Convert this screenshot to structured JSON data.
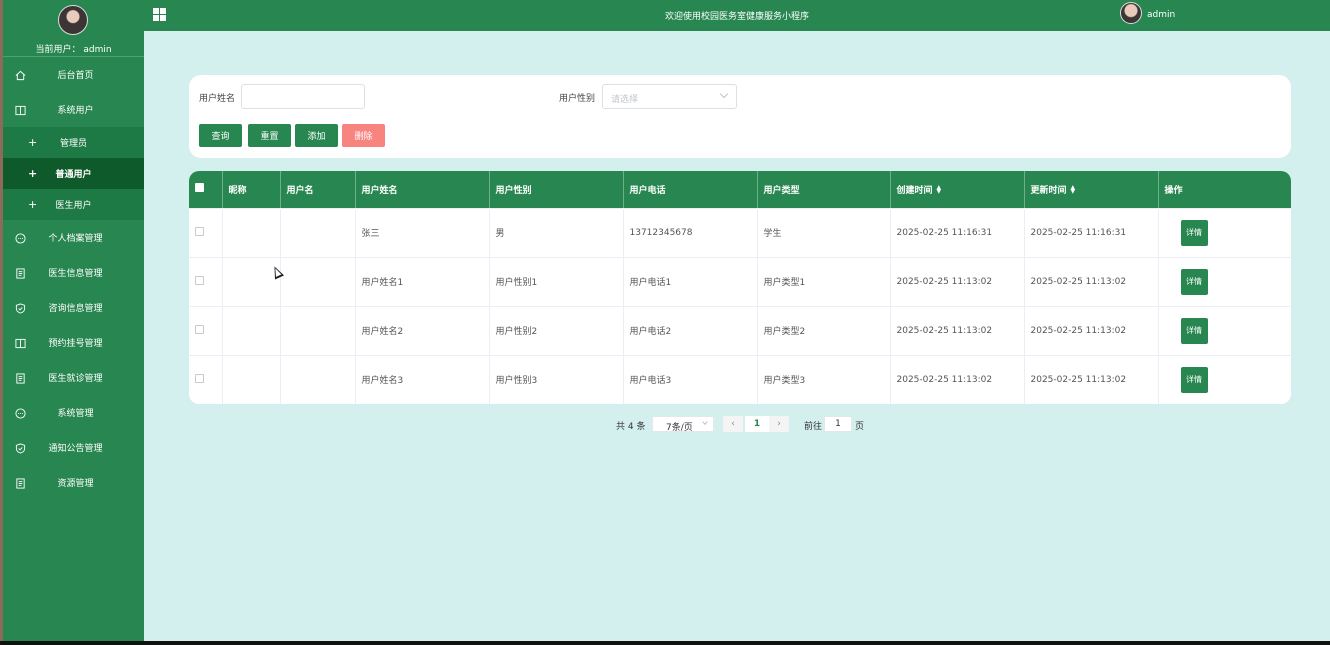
{
  "header": {
    "title": "欢迎使用校园医务室健康服务小程序",
    "username": "admin"
  },
  "sidebar": {
    "current_user_label": "当前用户：",
    "current_user_name": "admin",
    "items": [
      {
        "label": "后台首页",
        "icon": "home-icon"
      },
      {
        "label": "系统用户",
        "icon": "columns-icon"
      },
      {
        "label": "管理员",
        "sub": true
      },
      {
        "label": "普通用户",
        "sub": true,
        "active": true
      },
      {
        "label": "医生用户",
        "sub": true
      },
      {
        "label": "个人档案管理",
        "icon": "chat-icon"
      },
      {
        "label": "医生信息管理",
        "icon": "document-icon"
      },
      {
        "label": "咨询信息管理",
        "icon": "shield-icon"
      },
      {
        "label": "预约挂号管理",
        "icon": "columns-icon"
      },
      {
        "label": "医生就诊管理",
        "icon": "document-icon"
      },
      {
        "label": "系统管理",
        "icon": "chat-icon"
      },
      {
        "label": "通知公告管理",
        "icon": "shield-icon"
      },
      {
        "label": "资源管理",
        "icon": "document-icon"
      }
    ]
  },
  "search": {
    "name_label": "用户姓名",
    "name_value": "",
    "gender_label": "用户性别",
    "gender_placeholder": "请选择",
    "buttons": {
      "query": "查询",
      "reset": "重置",
      "add": "添加",
      "delete": "删除"
    }
  },
  "table": {
    "columns": [
      "昵称",
      "用户名",
      "用户姓名",
      "用户性别",
      "用户电话",
      "用户类型",
      "创建时间",
      "更新时间",
      "操作"
    ],
    "detail_label": "详情",
    "rows": [
      {
        "nickname": "",
        "username": "",
        "name": "张三",
        "gender": "男",
        "phone": "13712345678",
        "type": "学生",
        "created": "2025-02-25 11:16:31",
        "updated": "2025-02-25 11:16:31"
      },
      {
        "nickname": "",
        "username": "",
        "name": "用户姓名1",
        "gender": "用户性别1",
        "phone": "用户电话1",
        "type": "用户类型1",
        "created": "2025-02-25 11:13:02",
        "updated": "2025-02-25 11:13:02"
      },
      {
        "nickname": "",
        "username": "",
        "name": "用户姓名2",
        "gender": "用户性别2",
        "phone": "用户电话2",
        "type": "用户类型2",
        "created": "2025-02-25 11:13:02",
        "updated": "2025-02-25 11:13:02"
      },
      {
        "nickname": "",
        "username": "",
        "name": "用户姓名3",
        "gender": "用户性别3",
        "phone": "用户电话3",
        "type": "用户类型3",
        "created": "2025-02-25 11:13:02",
        "updated": "2025-02-25 11:13:02"
      }
    ]
  },
  "pagination": {
    "total": "共 4 条",
    "page_size": "7条/页",
    "current_page": "1",
    "goto_label": "前往",
    "goto_value": "1",
    "page_suffix": "页"
  },
  "colors": {
    "primary": "#288750",
    "danger": "#f88480",
    "background": "#d3f0ee"
  }
}
